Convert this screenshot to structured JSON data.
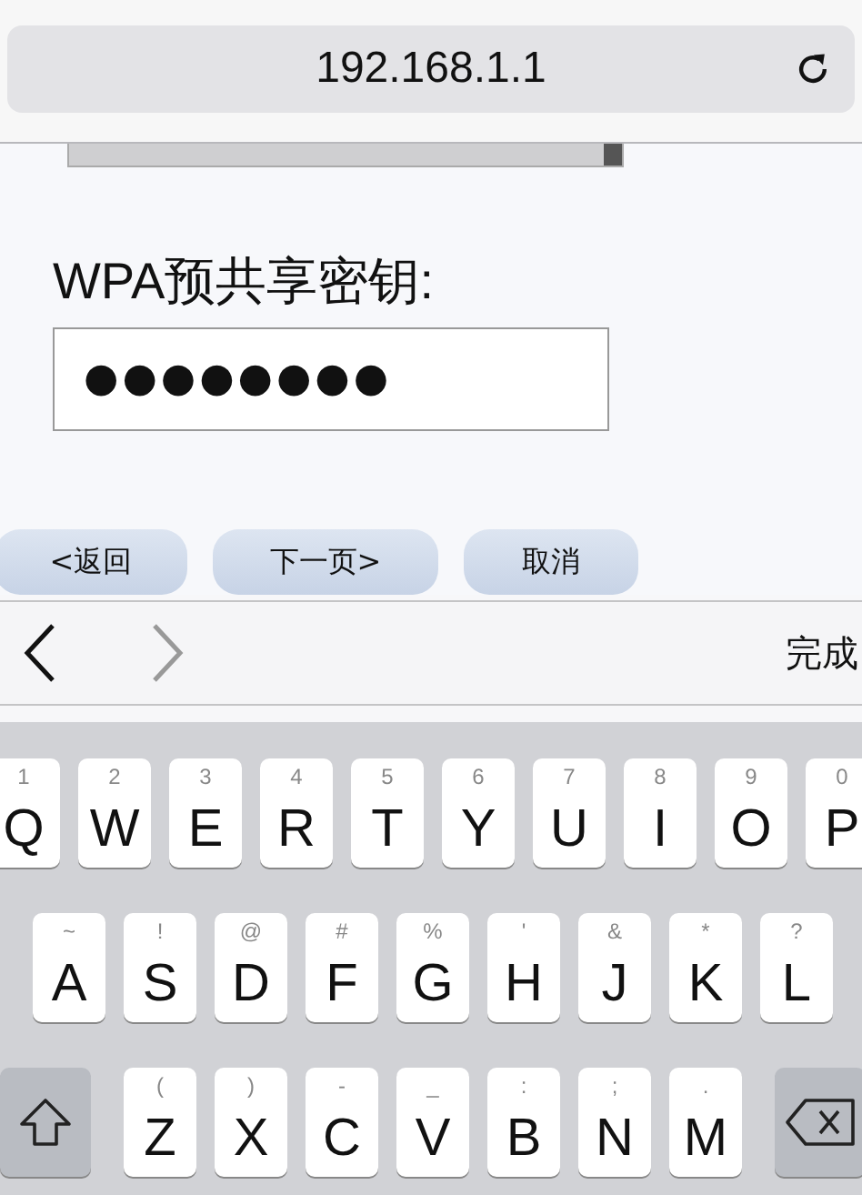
{
  "address_bar": {
    "url": "192.168.1.1"
  },
  "form": {
    "label": "WPA预共享密钥:",
    "password_field": {
      "value": "●●●●●●●●"
    }
  },
  "buttons": [
    {
      "label": "<返回"
    },
    {
      "label": "下一页>"
    },
    {
      "label": "取消"
    }
  ],
  "toolbar": {
    "back": {
      "disabled": false
    },
    "forward": {
      "disabled": true
    },
    "done": "完成"
  },
  "keyboard": {
    "rows": [
      [
        {
          "kind": "letter",
          "hint": "1",
          "letter": "Q"
        },
        {
          "kind": "letter",
          "hint": "2",
          "letter": "W"
        },
        {
          "kind": "letter",
          "hint": "3",
          "letter": "E"
        },
        {
          "kind": "letter",
          "hint": "4",
          "letter": "R"
        },
        {
          "kind": "letter",
          "hint": "5",
          "letter": "T"
        },
        {
          "kind": "letter",
          "hint": "6",
          "letter": "Y"
        },
        {
          "kind": "letter",
          "hint": "7",
          "letter": "U"
        },
        {
          "kind": "letter",
          "hint": "8",
          "letter": "I"
        },
        {
          "kind": "letter",
          "hint": "9",
          "letter": "O"
        },
        {
          "kind": "letter",
          "hint": "0",
          "letter": "P"
        }
      ],
      [
        {
          "kind": "letter",
          "hint": "~",
          "letter": "A"
        },
        {
          "kind": "letter",
          "hint": "!",
          "letter": "S"
        },
        {
          "kind": "letter",
          "hint": "@",
          "letter": "D"
        },
        {
          "kind": "letter",
          "hint": "#",
          "letter": "F"
        },
        {
          "kind": "letter",
          "hint": "%",
          "letter": "G"
        },
        {
          "kind": "letter",
          "hint": "'",
          "letter": "H"
        },
        {
          "kind": "letter",
          "hint": "&",
          "letter": "J"
        },
        {
          "kind": "letter",
          "hint": "*",
          "letter": "K"
        },
        {
          "kind": "letter",
          "hint": "?",
          "letter": "L"
        }
      ],
      [
        {
          "kind": "shift"
        },
        {
          "kind": "letter",
          "hint": "(",
          "letter": "Z"
        },
        {
          "kind": "letter",
          "hint": ")",
          "letter": "X"
        },
        {
          "kind": "letter",
          "hint": "-",
          "letter": "C"
        },
        {
          "kind": "letter",
          "hint": "_",
          "letter": "V"
        },
        {
          "kind": "letter",
          "hint": ":",
          "letter": "B"
        },
        {
          "kind": "letter",
          "hint": ";",
          "letter": "N"
        },
        {
          "kind": "letter",
          "hint": ".",
          "letter": "M"
        },
        {
          "kind": "delete"
        }
      ]
    ]
  }
}
